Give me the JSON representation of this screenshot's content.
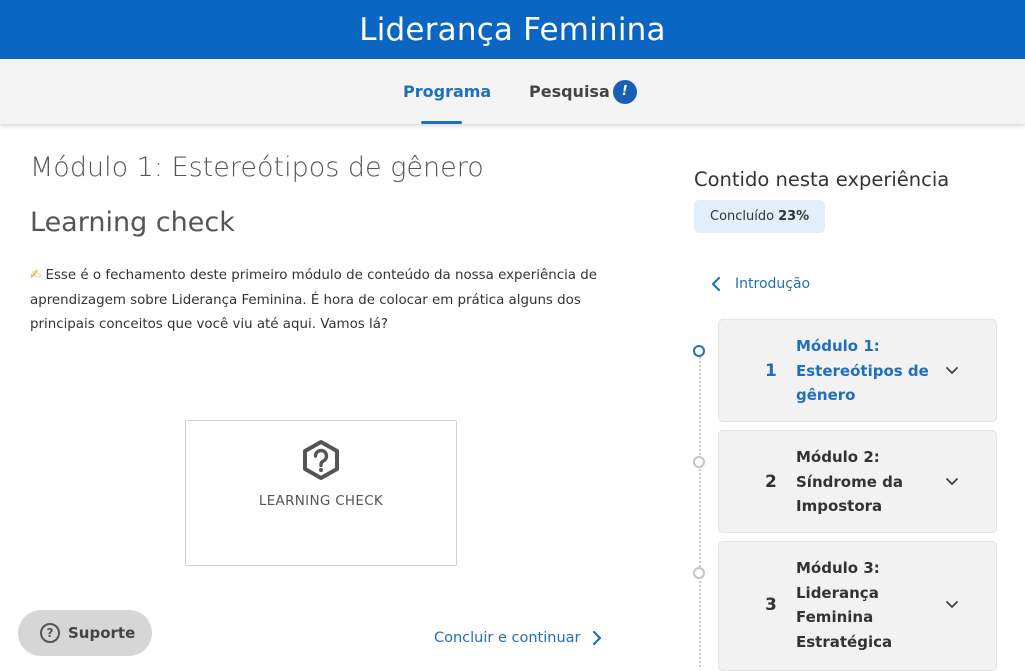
{
  "header": {
    "title": "Liderança Feminina"
  },
  "tabs": [
    {
      "label": "Programa",
      "active": true
    },
    {
      "label": "Pesquisa",
      "badge": "!"
    }
  ],
  "main": {
    "module_title": "Módulo 1: Estereótipos de gênero",
    "section_title": "Learning check",
    "intro_emoji": "✍",
    "intro_text": "Esse é o fechamento deste primeiro módulo de conteúdo da nossa experiência de aprendizagem sobre Liderança Feminina. É hora de colocar em prática alguns dos principais conceitos que você viu até aqui. Vamos lá?",
    "card_label": "LEARNING CHECK",
    "card_icon": "question-hexagon-icon",
    "continue_label": "Concluir e continuar"
  },
  "support": {
    "label": "Suporte",
    "icon": "question-circle-icon"
  },
  "sidebar": {
    "title": "Contido nesta experiência",
    "progress_label": "Concluído",
    "progress_value": "23%",
    "progress_fraction": 0.23,
    "back_link": "Introdução",
    "modules": [
      {
        "number": "1",
        "name": "Módulo 1: Estereótipos de gênero",
        "active": true
      },
      {
        "number": "2",
        "name": "Módulo 2: Síndrome da Impostora",
        "active": false
      },
      {
        "number": "3",
        "name": "Módulo 3: Liderança Feminina Estratégica",
        "active": false
      }
    ]
  },
  "colors": {
    "brand": "#0a66c2",
    "link": "#1f6fbf",
    "badge_bg": "#e2effb"
  }
}
